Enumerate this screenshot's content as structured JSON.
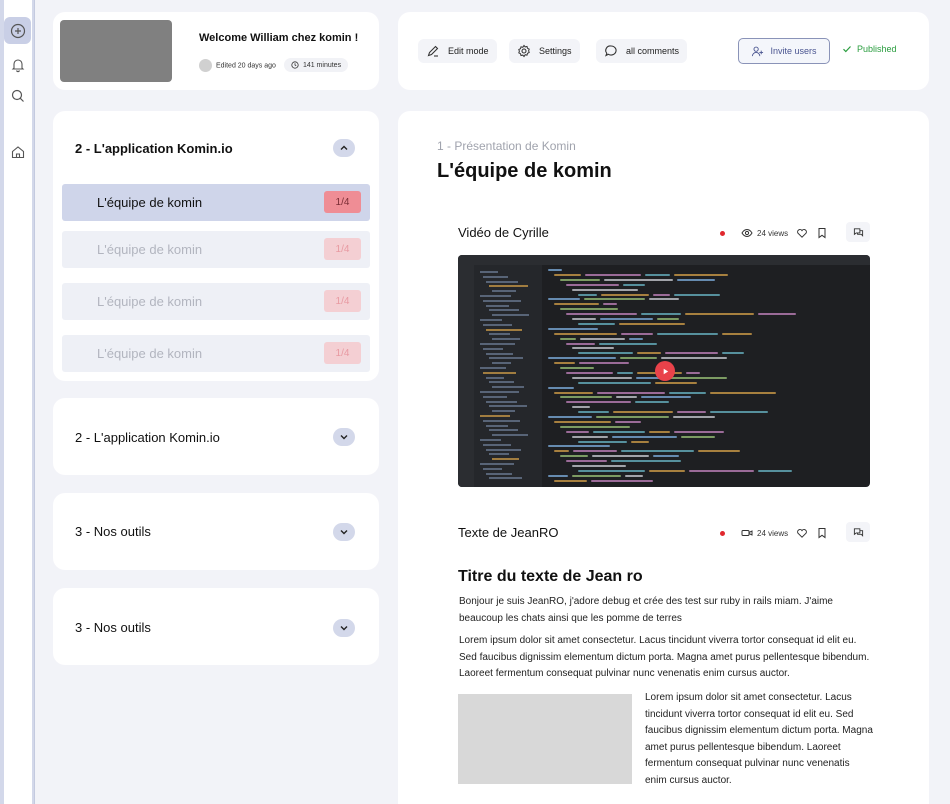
{
  "header": {
    "welcome": "Welcome William chez komin !",
    "edited": "Edited 20 days ago",
    "duration": "141 minutes"
  },
  "toolbar": {
    "edit_mode": "Edit mode",
    "settings": "Settings",
    "all_comments": "all comments",
    "invite": "Invite users",
    "status": "Published"
  },
  "sections": [
    {
      "title": "2 - L'application Komin.io",
      "expanded": true,
      "lessons": [
        {
          "title": "L'équipe de komin",
          "count": "1/4",
          "active": true
        },
        {
          "title": "L'équipe de komin",
          "count": "1/4",
          "active": false
        },
        {
          "title": "L'équipe de komin",
          "count": "1/4",
          "active": false
        },
        {
          "title": "L'équipe de komin",
          "count": "1/4",
          "active": false
        }
      ]
    },
    {
      "title": "2 - L'application Komin.io",
      "expanded": false
    },
    {
      "title": "3 - Nos outils",
      "expanded": false
    },
    {
      "title": "3 - Nos outils",
      "expanded": false
    }
  ],
  "content": {
    "breadcrumb": "1 - Présentation de Komin",
    "title": "L'équipe de komin",
    "items": [
      {
        "title": "Vidéo de Cyrille",
        "views": "24 views",
        "type": "video"
      },
      {
        "title": "Texte de JeanRO",
        "views": "24 views",
        "type": "text"
      }
    ],
    "text_block": {
      "heading": "Titre du texte de Jean ro",
      "intro": "Bonjour je suis JeanRO, j'adore debug et crée des test sur ruby in rails miam. J'aime beaucoup les chats ainsi que les pomme de terres",
      "body": "Lorem ipsum dolor sit amet consectetur. Lacus tincidunt viverra tortor consequat id elit eu. Sed faucibus dignissim elementum dictum porta. Magna amet purus pellentesque bibendum. Laoreet fermentum consequat pulvinar nunc venenatis enim cursus auctor.",
      "side": "Lorem ipsum dolor sit amet consectetur. Lacus tincidunt viverra tortor consequat id elit eu. Sed faucibus dignissim elementum dictum porta. Magna amet purus pellentesque bibendum. Laoreet fermentum consequat pulvinar nunc venenatis enim cursus auctor."
    }
  },
  "icons": {
    "rail": [
      "add-icon",
      "bell-icon",
      "search-icon",
      "home-icon"
    ],
    "toolbar": [
      "pencil-icon",
      "gear-icon",
      "chat-icon",
      "user-plus-icon",
      "check-icon"
    ]
  },
  "colors": {
    "accent": "#cfd5ea",
    "published": "#2a9d3f",
    "count_badge": "#ef8d95",
    "record_dot": "#e0282e"
  }
}
